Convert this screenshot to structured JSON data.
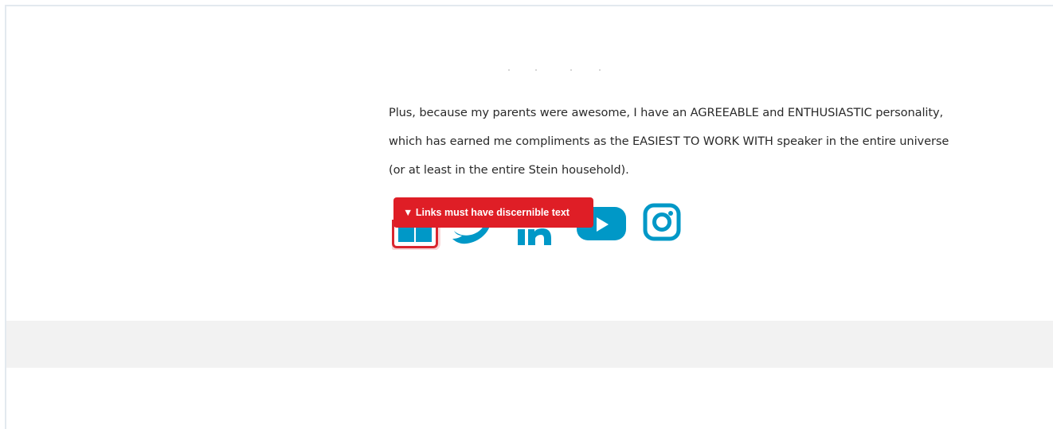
{
  "bio": {
    "lines": [
      "Plus, because my parents were awesome, I have an AGREEABLE and ENTHUSIASTIC personality,",
      "which has earned me compliments as the EASIEST TO WORK WITH speaker in the entire universe",
      "(or at least in the entire Stein household)."
    ]
  },
  "social": {
    "icon_color": "#0098c7",
    "icons": [
      "facebook-icon",
      "twitter-icon",
      "linkedin-icon",
      "youtube-icon",
      "instagram-icon"
    ]
  },
  "accessibility_tooltip": {
    "text": "▼ Links must have discernible text",
    "color": "#df1e26"
  }
}
